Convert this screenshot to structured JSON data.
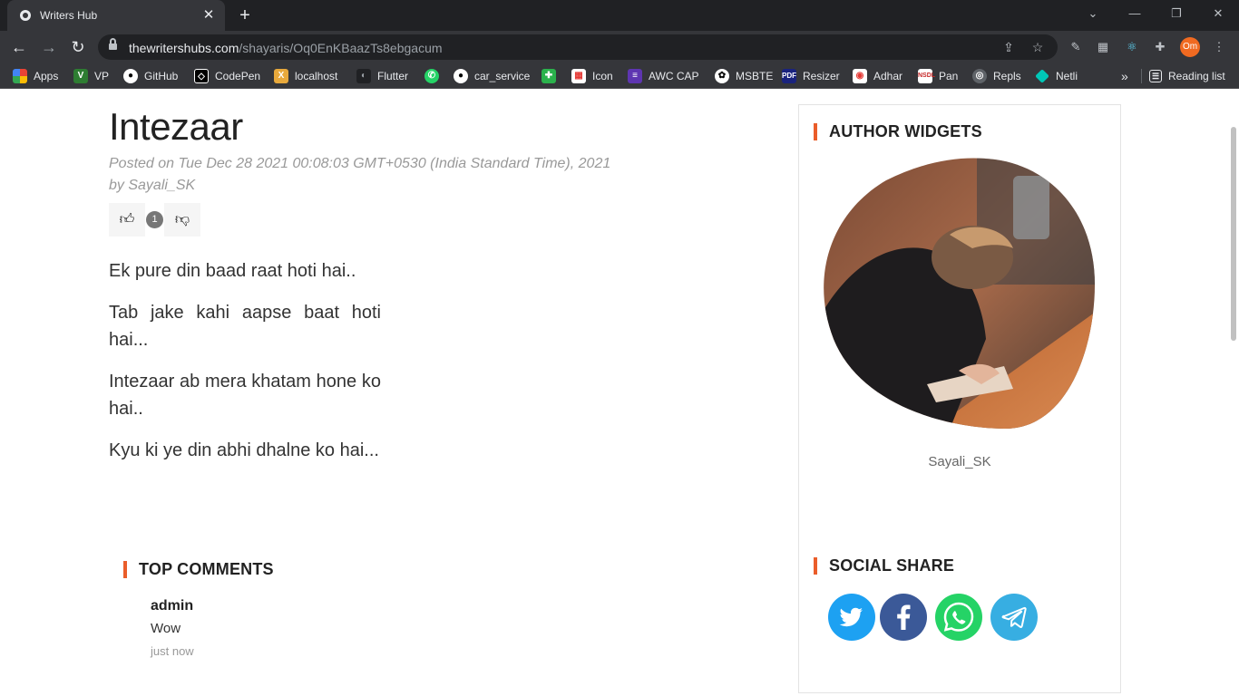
{
  "browser": {
    "tab_title": "Writers Hub",
    "url_domain": "thewritershubs.com",
    "url_path": "/shayaris/Oq0EnKBaazTs8ebgacum",
    "profile_initials": "Om",
    "bookmarks": [
      {
        "label": "Apps",
        "color": "#e8453c"
      },
      {
        "label": "VP",
        "color": "#2e7d32"
      },
      {
        "label": "GitHub",
        "color": "#ffffff"
      },
      {
        "label": "CodePen",
        "color": "#ffffff"
      },
      {
        "label": "localhost",
        "color": "#e8a93c"
      },
      {
        "label": "Flutter",
        "color": "#54c5f8"
      },
      {
        "label": "",
        "color": "#25d366"
      },
      {
        "label": "car_service",
        "color": "#ffffff"
      },
      {
        "label": "",
        "color": "#2bb24c"
      },
      {
        "label": "Icon",
        "color": "#e53935"
      },
      {
        "label": "AWC CAP",
        "color": "#5e35b1"
      },
      {
        "label": "MSBTE",
        "color": "#ffffff"
      },
      {
        "label": "Resizer",
        "color": "#1a237e"
      },
      {
        "label": "Adhar",
        "color": "#e53935"
      },
      {
        "label": "Pan",
        "color": "#c62828"
      },
      {
        "label": "Repls",
        "color": "#9aa0a6"
      },
      {
        "label": "Netli",
        "color": "#00c7b7"
      }
    ],
    "more_chevron": "»",
    "reading_list": "Reading list"
  },
  "post": {
    "title": "Intezaar",
    "posted_on": "Posted on Tue Dec 28 2021 00:08:03 GMT+0530 (India Standard Time), 2021",
    "by": "by Sayali_SK",
    "like_count": "1",
    "lines": [
      "Ek pure din baad raat hoti hai..",
      "Tab jake kahi aapse baat hoti hai...",
      "Intezaar ab mera khatam hone ko hai..",
      "Kyu ki ye din abhi dhalne ko hai..."
    ]
  },
  "comments": {
    "heading": "TOP COMMENTS",
    "items": [
      {
        "author": "admin",
        "text": "Wow",
        "time": "just now"
      }
    ]
  },
  "sidebar": {
    "author_heading": "AUTHOR WIDGETS",
    "author_name": "Sayali_SK",
    "share_heading": "SOCIAL SHARE",
    "share_buttons": [
      {
        "name": "twitter",
        "color": "#1da1f2"
      },
      {
        "name": "facebook",
        "color": "#3b5998"
      },
      {
        "name": "whatsapp",
        "color": "#25d366"
      },
      {
        "name": "telegram",
        "color": "#37aee2"
      }
    ]
  },
  "accent_color": "#ea5d2a"
}
